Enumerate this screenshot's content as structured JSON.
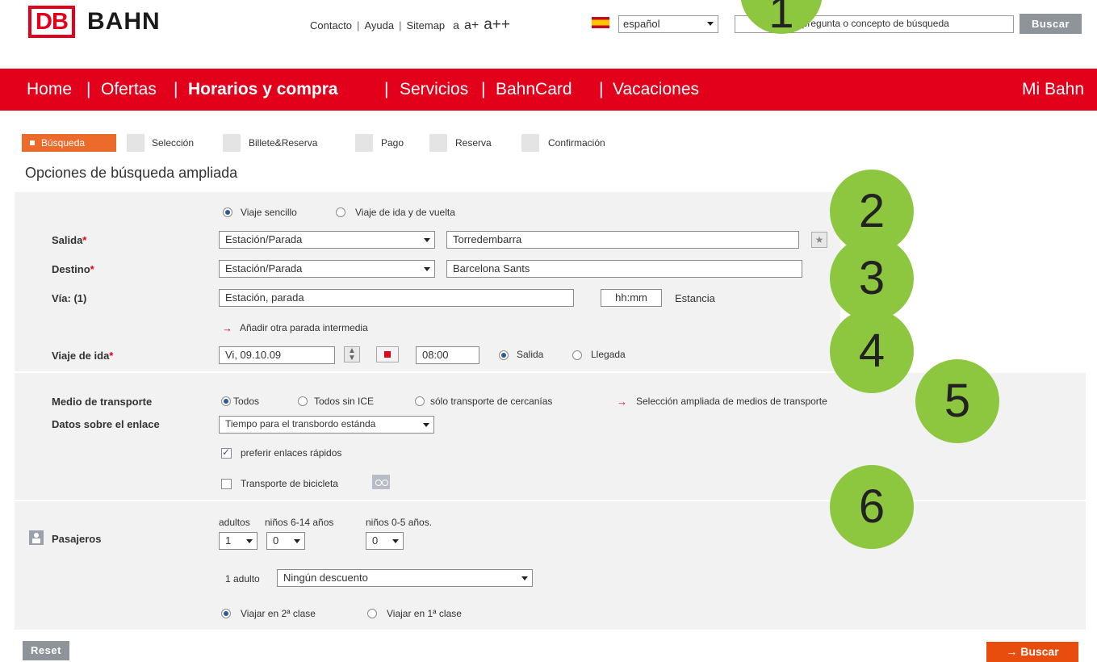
{
  "brand": {
    "logo_mark": "DB",
    "logo_text": "BAHN",
    "accent": "#e2001a"
  },
  "top": {
    "links": [
      "Contacto",
      "Ayuda",
      "Sitemap"
    ],
    "font_sizes": [
      "a",
      "a+",
      "a++"
    ],
    "language": "español",
    "search_placeholder": "ucir pregunta o concepto de búsqueda",
    "search_button": "Buscar"
  },
  "nav": {
    "items": [
      "Home",
      "Ofertas",
      "Horarios y compra",
      "Servicios",
      "BahnCard",
      "Vacaciones"
    ],
    "active": "Horarios y compra",
    "right": "Mi Bahn",
    "separator": "|"
  },
  "steps": [
    "Búsqueda",
    "Selección",
    "Billete&Reserva",
    "Pago",
    "Reserva",
    "Confirmación"
  ],
  "heading": "Opciones de búsqueda ampliada",
  "trip": {
    "options": [
      "Viaje sencillo",
      "Viaje de ida y de vuelta"
    ],
    "from_label": "Salida",
    "from_type": "Estación/Parada",
    "from_value": "Torredembarra",
    "to_label": "Destino",
    "to_type": "Estación/Parada",
    "to_value": "Barcelona Sants",
    "via_label": "Vía: (1)",
    "via_placeholder": "Estación, parada",
    "stay_placeholder": "hh:mm",
    "stay_label": "Estancia",
    "add_stop": "Añadir otra parada intermedia",
    "outbound_label": "Viaje de ida",
    "date": "Vi, 09.10.09",
    "time": "08:00",
    "time_options": [
      "Salida",
      "Llegada"
    ],
    "required_mark": "*"
  },
  "transport": {
    "label": "Medio de transporte",
    "options": [
      "Todos",
      "Todos sin ICE",
      "sólo transporte de cercanías"
    ],
    "extended_link": "Selección ampliada de medios de transporte",
    "connection_label": "Datos sobre el enlace",
    "transfer_time": "Tiempo para el transbordo estánda",
    "fast_connections": "preferir enlaces rápidos",
    "bicycle": "Transporte de bicicleta"
  },
  "passengers": {
    "label": "Pasajeros",
    "headers": [
      "adultos",
      "niños 6-14 años",
      "niños 0-5 años."
    ],
    "adults": "1",
    "kids_6_14": "0",
    "kids_0_5": "0",
    "adult_row_label": "1 adulto",
    "discount": "Ningún descuento",
    "class_options": [
      "Viajar en 2ª clase",
      "Viajar en 1ª clase"
    ]
  },
  "buttons": {
    "reset": "Reset",
    "search": "→ Buscar"
  },
  "markers": [
    "1",
    "2",
    "3",
    "4",
    "5",
    "6"
  ],
  "colors": {
    "red": "#e2001a",
    "orange": "#ec6a2a",
    "marker_green": "#8dc63f",
    "panel_gray": "#f2f2f2"
  }
}
